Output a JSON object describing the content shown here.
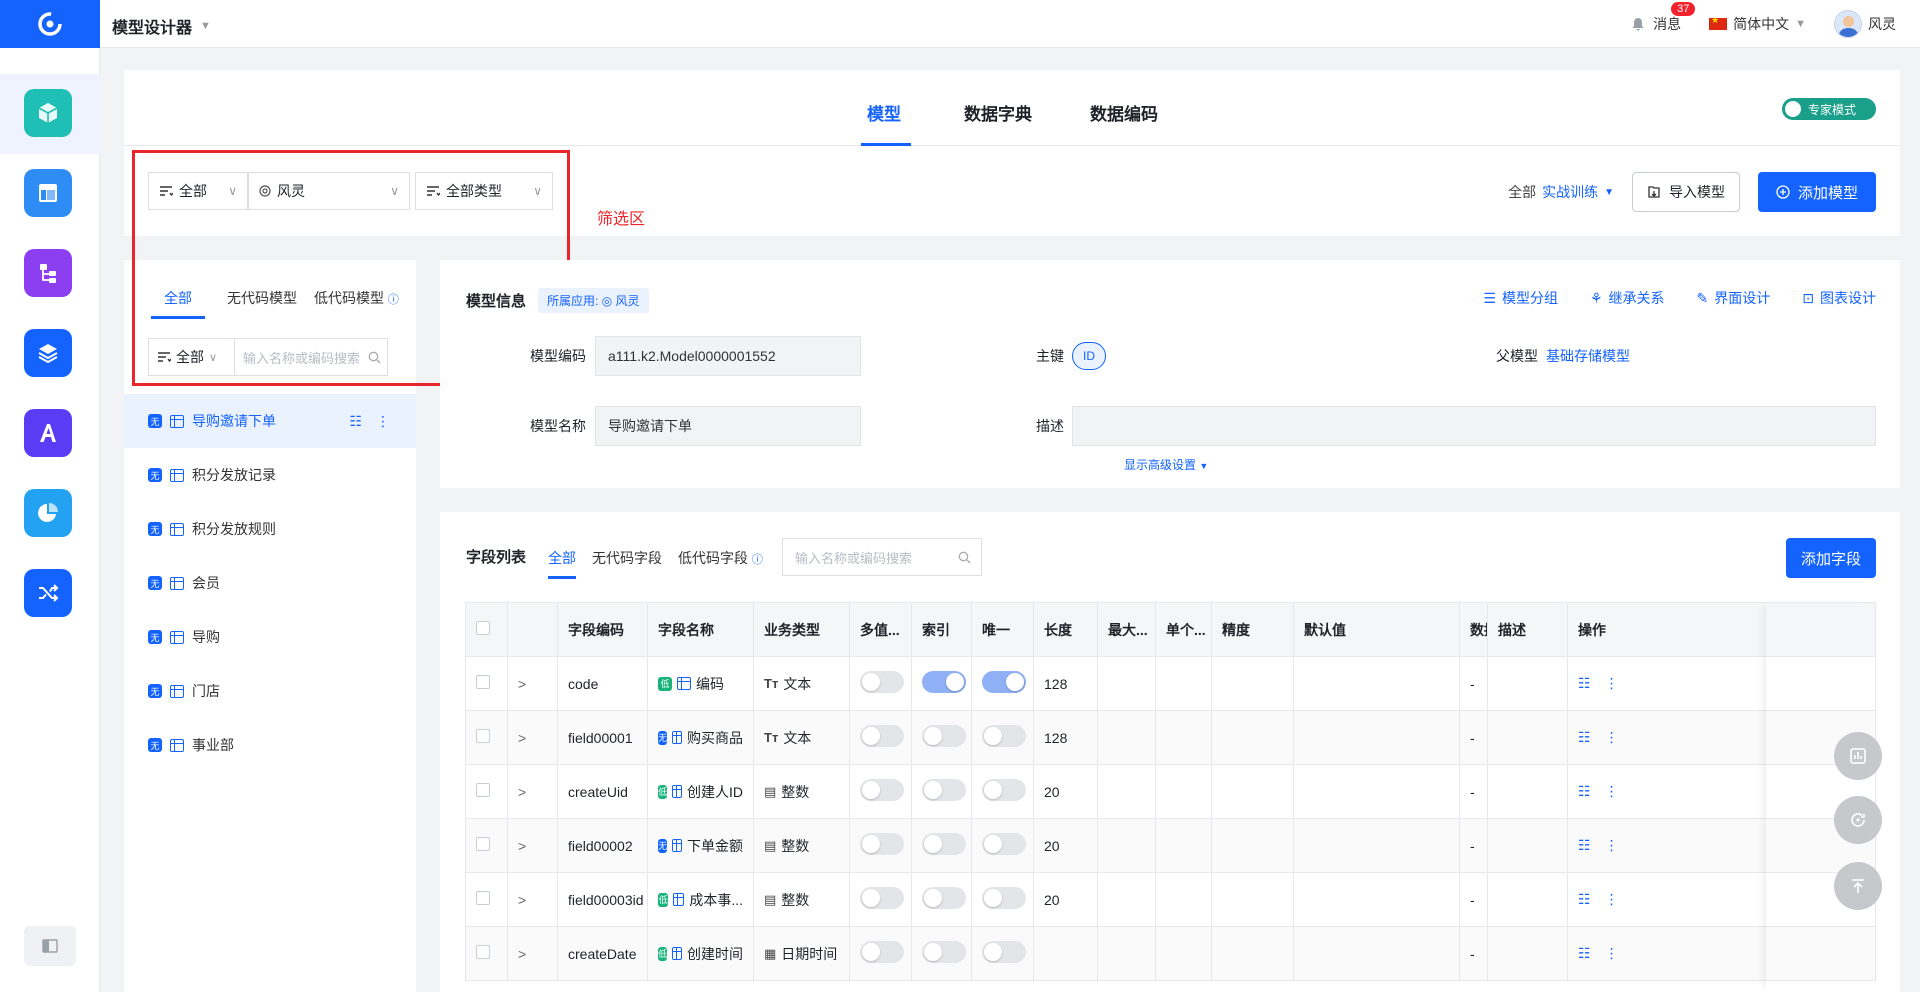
{
  "app": {
    "title": "模型设计器"
  },
  "topbar": {
    "messages_label": "消息",
    "messages_count": "37",
    "language": "简体中文",
    "user_name": "风灵"
  },
  "colors": {
    "primary": "#1463ff",
    "annotation": "#e8262c",
    "expert_toggle": "#1aa08a"
  },
  "nav": {
    "icons": [
      {
        "name": "model-icon",
        "color": "#1fbfb5"
      },
      {
        "name": "layout-icon",
        "color": "#2e8cf5"
      },
      {
        "name": "flow-icon",
        "color": "#8b3ff0"
      },
      {
        "name": "layers-icon",
        "color": "#1463ff"
      },
      {
        "name": "ai-icon",
        "color": "#5a3cf5"
      },
      {
        "name": "chart-icon",
        "color": "#22a2f0"
      },
      {
        "name": "shuffle-icon",
        "color": "#1463ff"
      }
    ]
  },
  "main_tabs": {
    "model": "模型",
    "dictionary": "数据字典",
    "encoding": "数据编码"
  },
  "expert_mode": "专家模式",
  "filters": {
    "scope": "全部",
    "owner": "风灵",
    "type": "全部类型"
  },
  "annotation": {
    "label": "筛选区"
  },
  "toolbar": {
    "scope_label": "全部",
    "scope_link": "实战训练",
    "import_button": "导入模型",
    "add_button": "添加模型"
  },
  "left_panel": {
    "tabs": {
      "all": "全部",
      "no_code": "无代码模型",
      "low_code": "低代码模型"
    },
    "search_scope": "全部",
    "search_placeholder": "输入名称或编码搜索",
    "items": [
      {
        "label": "导购邀请下单",
        "tag": "无"
      },
      {
        "label": "积分发放记录",
        "tag": "无"
      },
      {
        "label": "积分发放规则",
        "tag": "无"
      },
      {
        "label": "会员",
        "tag": "无"
      },
      {
        "label": "导购",
        "tag": "无"
      },
      {
        "label": "门店",
        "tag": "无"
      },
      {
        "label": "事业部",
        "tag": "无"
      }
    ]
  },
  "model_info": {
    "title": "模型信息",
    "app_tag_label": "所属应用:",
    "app_tag_value": "风灵",
    "links": {
      "group": "模型分组",
      "inherit": "继承关系",
      "ui": "界面设计",
      "chart": "图表设计"
    },
    "code_label": "模型编码",
    "code_value": "a111.k2.Model0000001552",
    "pk_label": "主键",
    "pk_value": "ID",
    "parent_label": "父模型",
    "parent_value": "基础存储模型",
    "name_label": "模型名称",
    "name_value": "导购邀请下单",
    "desc_label": "描述",
    "desc_value": "",
    "advanced": "显示高级设置"
  },
  "field_list": {
    "title": "字段列表",
    "tabs": {
      "all": "全部",
      "no_code": "无代码字段",
      "low_code": "低代码字段"
    },
    "search_placeholder": "输入名称或编码搜索",
    "add_button": "添加字段",
    "columns": [
      "字段编码",
      "字段名称",
      "业务类型",
      "多值...",
      "索引",
      "唯一",
      "长度",
      "最大...",
      "单个...",
      "精度",
      "默认值",
      "数据编码",
      "描述",
      "操作"
    ],
    "rows": [
      {
        "code": "code",
        "tag": "低",
        "name": "编码",
        "biz_icon": "Tт",
        "biz": "文本",
        "multi": false,
        "index": true,
        "unique": true,
        "length": "128",
        "data_code": "-"
      },
      {
        "code": "field00001",
        "tag": "无",
        "name": "购买商品",
        "biz_icon": "Tт",
        "biz": "文本",
        "multi": false,
        "index": false,
        "unique": false,
        "length": "128",
        "data_code": "-"
      },
      {
        "code": "createUid",
        "tag": "低",
        "name": "创建人ID",
        "biz_icon": "▤",
        "biz": "整数",
        "multi": false,
        "index": false,
        "unique": false,
        "length": "20",
        "data_code": "-"
      },
      {
        "code": "field00002",
        "tag": "无",
        "name": "下单金额",
        "biz_icon": "▤",
        "biz": "整数",
        "multi": false,
        "index": false,
        "unique": false,
        "length": "20",
        "data_code": "-"
      },
      {
        "code": "field00003id",
        "tag": "低",
        "name": "成本事...",
        "biz_icon": "▤",
        "biz": "整数",
        "multi": false,
        "index": false,
        "unique": false,
        "length": "20",
        "data_code": "-"
      },
      {
        "code": "createDate",
        "tag": "低",
        "name": "创建时间",
        "biz_icon": "▦",
        "biz": "日期时间",
        "multi": false,
        "index": false,
        "unique": false,
        "length": "",
        "data_code": "-"
      }
    ]
  }
}
